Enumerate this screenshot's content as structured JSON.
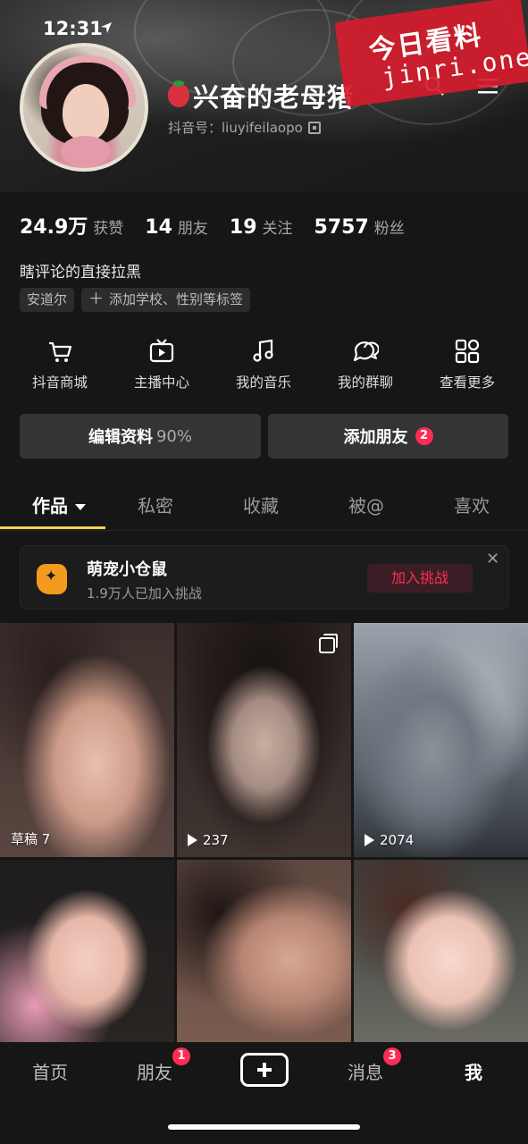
{
  "status_bar": {
    "time": "12:31"
  },
  "profile": {
    "nickname": "兴奋的老母猪",
    "douyin_id": "抖音号：liuyifeilaopo"
  },
  "watermark": {
    "title": "今日看料",
    "subtitle": "jinri.one"
  },
  "stats": [
    {
      "value": "24.9万",
      "label": "获赞"
    },
    {
      "value": "14",
      "label": "朋友"
    },
    {
      "value": "19",
      "label": "关注"
    },
    {
      "value": "5757",
      "label": "粉丝"
    }
  ],
  "bio": "瞎评论的直接拉黑",
  "tags": {
    "location": "安道尔",
    "add": "添加学校、性别等标签"
  },
  "quick_actions": [
    {
      "label": "抖音商城",
      "icon": "cart-icon"
    },
    {
      "label": "主播中心",
      "icon": "tv-icon"
    },
    {
      "label": "我的音乐",
      "icon": "music-icon"
    },
    {
      "label": "我的群聊",
      "icon": "chat-bubbles-icon"
    },
    {
      "label": "查看更多",
      "icon": "grid-more-icon"
    }
  ],
  "buttons": {
    "edit_profile": "编辑资料",
    "edit_profile_pct": "90%",
    "add_friend": "添加朋友",
    "add_friend_badge": "2"
  },
  "tabs": [
    "作品",
    "私密",
    "收藏",
    "被@",
    "喜欢"
  ],
  "challenge": {
    "title": "萌宠小仓鼠",
    "subtitle": "1.9万人已加入挑战",
    "button": "加入挑战",
    "close": "✕"
  },
  "videos": [
    {
      "label": "草稿 7",
      "play": false
    },
    {
      "label": "237",
      "play": true,
      "multi": true
    },
    {
      "label": "2074",
      "play": true
    },
    {
      "label": ""
    },
    {
      "label": ""
    },
    {
      "label": ""
    }
  ],
  "bottom_nav": {
    "home": "首页",
    "friends": "朋友",
    "friends_badge": "1",
    "messages": "消息",
    "messages_badge": "3",
    "me": "我"
  },
  "colors": {
    "accent": "#fe2c55",
    "tab_underline": "#f5d14b",
    "background": "#161616"
  }
}
